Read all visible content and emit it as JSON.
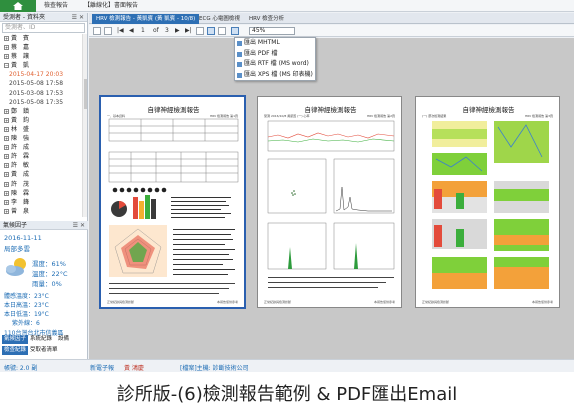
{
  "menubar": {
    "item1": "檢查報告",
    "item2": "【離線化】書面報告"
  },
  "left": {
    "header": "受測者 - 資料夾",
    "header_ctl": "☰ ✕",
    "search_placeholder": "受測者、ID",
    "tree": [
      {
        "label": "黃　賓",
        "type": "folder"
      },
      {
        "label": "蔡　嘉",
        "type": "folder"
      },
      {
        "label": "蔡　讓",
        "type": "folder"
      },
      {
        "label": "黃　凱",
        "type": "folder",
        "open": true
      },
      {
        "label": "2015-04-17 20:03",
        "type": "record",
        "hl": true
      },
      {
        "label": "2015-05-08 17:58",
        "type": "record"
      },
      {
        "label": "2015-03-08 17:53",
        "type": "record"
      },
      {
        "label": "2015-05-08 17:35",
        "type": "record"
      },
      {
        "label": "鄭　鎮",
        "type": "folder"
      },
      {
        "label": "黃　鈞",
        "type": "folder"
      },
      {
        "label": "林　盛",
        "type": "folder"
      },
      {
        "label": "陳　強",
        "type": "folder"
      },
      {
        "label": "許　成",
        "type": "folder"
      },
      {
        "label": "許　霖",
        "type": "folder"
      },
      {
        "label": "許　敏",
        "type": "folder"
      },
      {
        "label": "黃　成",
        "type": "folder"
      },
      {
        "label": "許　茂",
        "type": "folder"
      },
      {
        "label": "陳　霖",
        "type": "folder"
      },
      {
        "label": "李　鋒",
        "type": "folder"
      },
      {
        "label": "曾　泉",
        "type": "folder"
      }
    ],
    "weather_header": "氣候因子",
    "weather": {
      "date": "2016-11-11",
      "condition": "局部多雲",
      "humidity": "濕度：61%",
      "temperature": "溫度：22°C",
      "rain": "雨量：0%",
      "feels": "體感溫度：23°C",
      "high": "本日高溫：23°C",
      "low": "本日低溫：19°C",
      "uv": "紫外線：6",
      "source": "110台灣台北市信義區"
    },
    "tabs": [
      "氣候因子",
      "系統紀錄",
      "設備"
    ],
    "tabs2": [
      "檢查紀錄",
      "受取者清單"
    ]
  },
  "doc_tabs": [
    {
      "label": "HRV 檢測報告 - 黃凱賓 (黃 凱賓 - 10/8)",
      "active": true
    },
    {
      "label": "ECG 心電圖檢視",
      "active": false
    },
    {
      "label": "HRV 檢查分析",
      "active": false
    }
  ],
  "toolbar": {
    "page": "1",
    "of": "of",
    "total": "3",
    "zoom": "45%"
  },
  "export_menu": [
    "匯出 MHTML",
    "匯出 PDF 檔",
    "匯出 RTF 檔 (MS word)",
    "匯出 XPS 檔 (MS 印表機)"
  ],
  "pages": [
    {
      "title": "自律神經檢測報告",
      "sub_left": "一、基本資料",
      "sub_right": "HRV 檢測報告 第1頁",
      "foot_left": "正常紀錄與檢測診斷",
      "foot_right": "本報告僅供參考"
    },
    {
      "title": "自律神經檢測報告",
      "sub_left": "受測 2016/10/8 黃凱賓 (一) 心率",
      "sub_right": "HRV 檢測報告 第2頁",
      "foot_left": "正常紀錄與檢測診斷",
      "foot_right": "本報告僅供參考"
    },
    {
      "title": "自律神經檢測報告",
      "sub_left": "(一) 歷次檢測結果",
      "sub_right": "HRV 檢測報告 第3頁",
      "foot_left": "正常紀錄與檢測診斷",
      "foot_right": "本報告僅供參考"
    }
  ],
  "status": {
    "left": "帳號: 2.0 副",
    "mid1": "新電子報",
    "mid2": "黃 鴻慶",
    "right": "[檔案]主機: 診斷技術公司"
  },
  "caption": "診所版-(6)檢測報告範例 & PDF匯出Email",
  "colors": {
    "accent": "#2d6fb4",
    "home": "#2f8f3e",
    "weather_text": "#1e6db5"
  }
}
